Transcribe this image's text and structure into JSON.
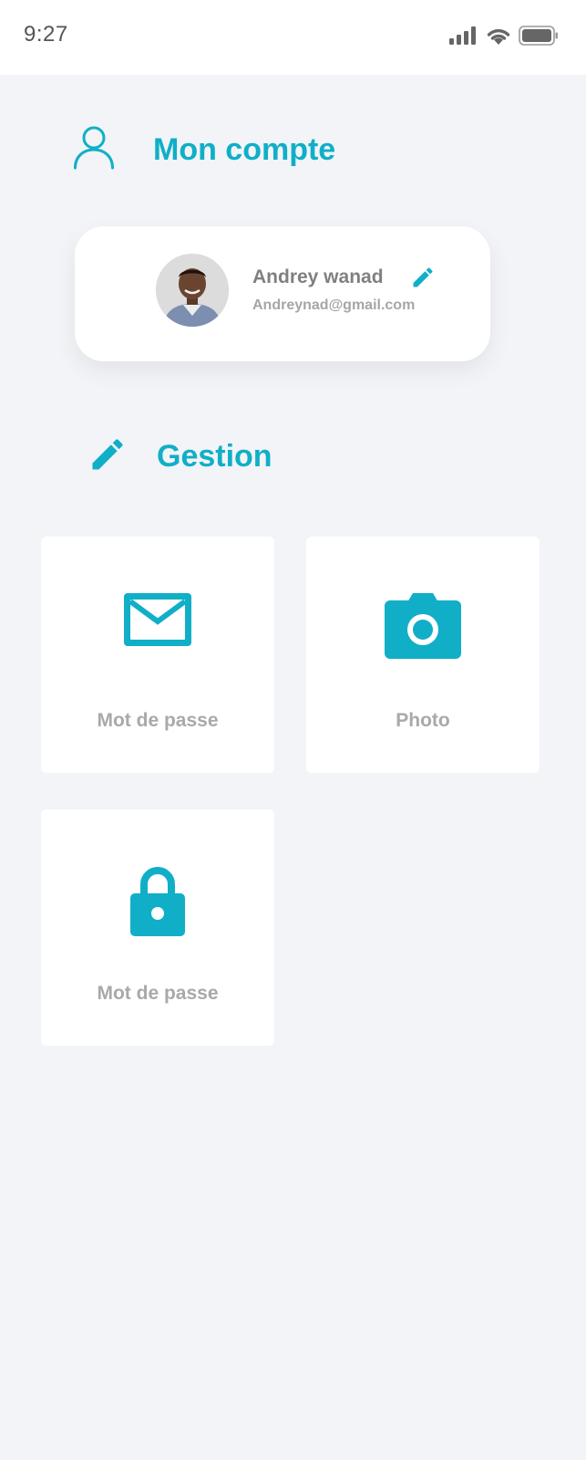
{
  "status_bar": {
    "time": "9:27",
    "icons": [
      "signal-icon",
      "wifi-icon",
      "battery-icon"
    ]
  },
  "account_section": {
    "title": "Mon compte",
    "icon": "user-icon"
  },
  "profile": {
    "name": "Andrey wanad",
    "email": "Andreynad@gmail.com",
    "avatar": "avatar-photo",
    "edit_icon": "pencil-icon"
  },
  "gestion_section": {
    "title": "Gestion",
    "icon": "pencil-icon"
  },
  "tiles": [
    {
      "label": "Mot de passe",
      "icon": "mail-icon"
    },
    {
      "label": "Photo",
      "icon": "camera-icon"
    },
    {
      "label": "Mot de passe",
      "icon": "lock-icon"
    }
  ],
  "colors": {
    "accent": "#10AFC7",
    "background": "#F2F4F7",
    "card": "#FFFFFF",
    "label_gray": "#A9A9A9",
    "name_gray": "#808080"
  }
}
